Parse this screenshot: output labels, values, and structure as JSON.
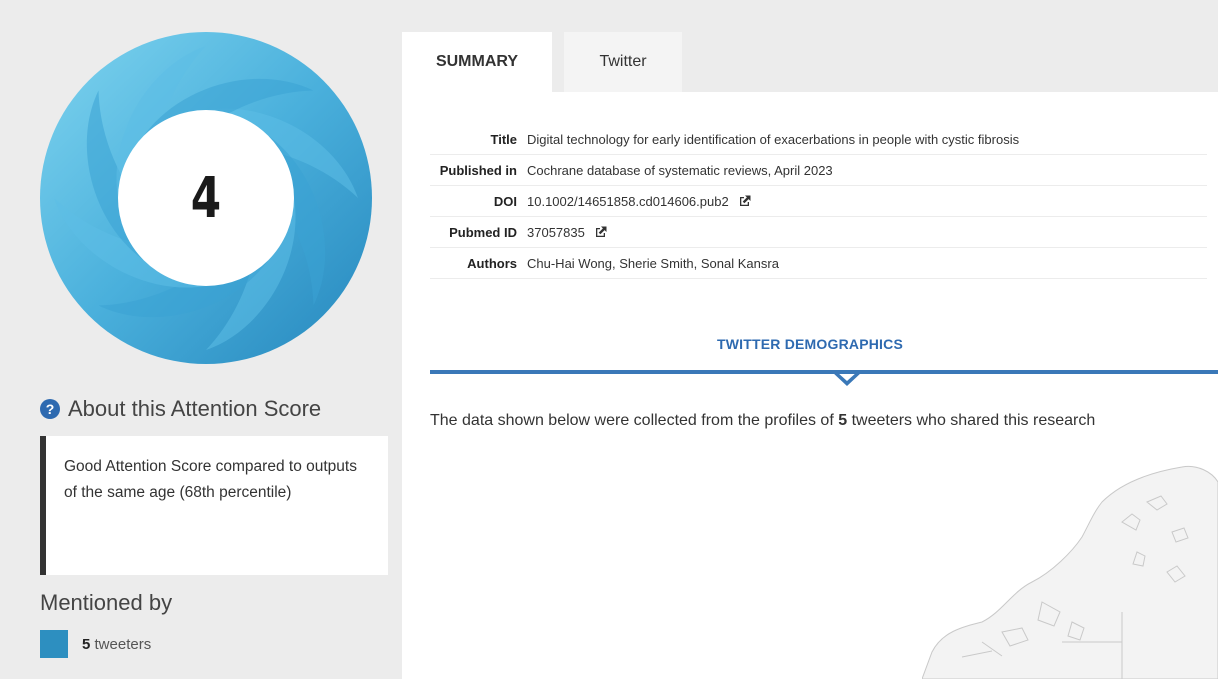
{
  "score": {
    "value": "4",
    "colors": {
      "twitter": "#2d8fc0",
      "ring_light": "#74cdeb",
      "ring_dark": "#2a8fc0"
    }
  },
  "about": {
    "heading": "About this Attention Score",
    "description": "Good Attention Score compared to outputs of the same age (68th percentile)"
  },
  "mentioned": {
    "heading": "Mentioned by",
    "items": [
      {
        "count": "5",
        "label": "tweeters",
        "color": "#2d8fc0"
      }
    ]
  },
  "tabs": [
    {
      "label": "SUMMARY",
      "active": true
    },
    {
      "label": "Twitter",
      "active": false
    }
  ],
  "summary": {
    "title_label": "Title",
    "title": "Digital technology for early identification of exacerbations in people with cystic fibrosis",
    "published_label": "Published in",
    "published": "Cochrane database of systematic reviews, April 2023",
    "doi_label": "DOI",
    "doi": "10.1002/14651858.cd014606.pub2",
    "pubmed_label": "Pubmed ID",
    "pubmed": "37057835",
    "authors_label": "Authors",
    "authors": "Chu-Hai Wong, Sherie Smith, Sonal Kansra"
  },
  "demographics": {
    "heading": "TWITTER DEMOGRAPHICS",
    "text_before": "The data shown below were collected from the profiles of ",
    "count": "5",
    "text_after": " tweeters who shared this research"
  },
  "icons": {
    "help": "question-circle-icon",
    "external": "external-link-icon"
  }
}
